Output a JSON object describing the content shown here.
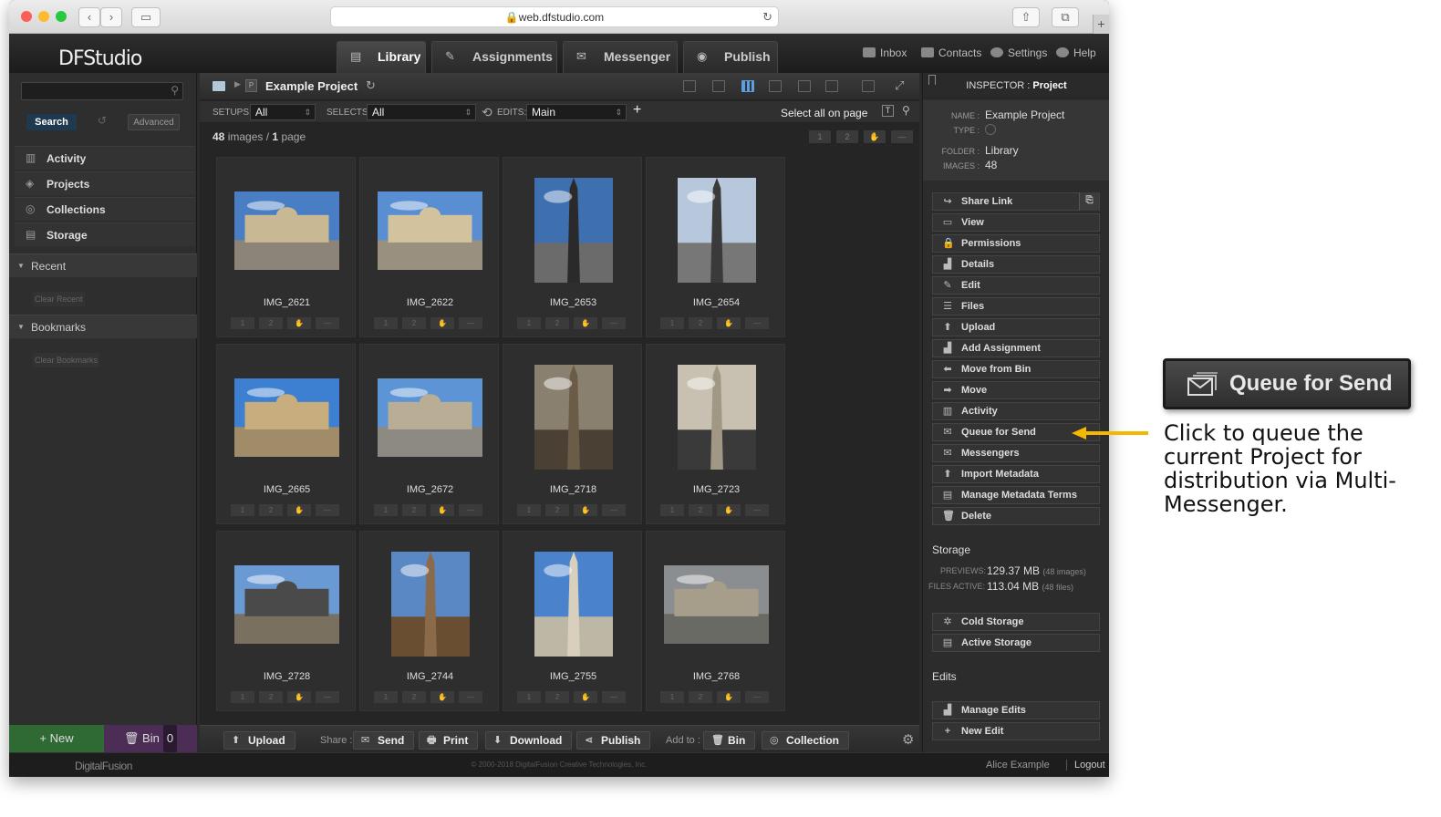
{
  "browser": {
    "url": "web.dfstudio.com"
  },
  "app": {
    "logo": "DFStudio"
  },
  "tabs": [
    {
      "label": "Library",
      "icon": "library-icon",
      "active": true
    },
    {
      "label": "Assignments",
      "icon": "assignments-icon",
      "active": false
    },
    {
      "label": "Messenger",
      "icon": "messenger-icon",
      "active": false
    },
    {
      "label": "Publish",
      "icon": "publish-icon",
      "active": false
    }
  ],
  "toplinks": [
    "Inbox",
    "Contacts",
    "Settings",
    "Help"
  ],
  "sidebar": {
    "search_button": "Search",
    "advanced_button": "Advanced",
    "nav": [
      "Activity",
      "Projects",
      "Collections",
      "Storage"
    ],
    "recent": {
      "title": "Recent",
      "clear": "Clear Recent"
    },
    "bookmarks": {
      "title": "Bookmarks",
      "clear": "Clear Bookmarks"
    },
    "new_button": "+ New",
    "bin_label": "Bin",
    "bin_count": "0"
  },
  "main": {
    "title": "Example Project",
    "setups_label": "SETUPS:",
    "setups_value": "All",
    "selects_label": "SELECTS:",
    "selects_value": "All",
    "edits_label": "EDITS:",
    "edits_value": "Main",
    "add": "+",
    "select_all": "Select all on page",
    "image_count": "48",
    "images_word": "images",
    "page_count": "1",
    "page_word": "page",
    "images": [
      "IMG_2621",
      "IMG_2622",
      "IMG_2653",
      "IMG_2654",
      "IMG_2665",
      "IMG_2672",
      "IMG_2718",
      "IMG_2723",
      "IMG_2728",
      "IMG_2744",
      "IMG_2755",
      "IMG_2768"
    ],
    "rating": [
      "1",
      "2"
    ],
    "bottom": {
      "upload": "Upload",
      "share_label": "Share :",
      "send": "Send",
      "print": "Print",
      "download": "Download",
      "publish": "Publish",
      "addto_label": "Add to :",
      "bin": "Bin",
      "collection": "Collection"
    }
  },
  "inspector": {
    "header_prefix": "INSPECTOR :",
    "header_obj": "Project",
    "name_key": "NAME :",
    "name_val": "Example Project",
    "type_key": "TYPE :",
    "folder_key": "FOLDER :",
    "folder_val": "Library",
    "images_key": "IMAGES :",
    "images_val": "48",
    "actions": [
      "Share Link",
      "View",
      "Permissions",
      "Details",
      "Edit",
      "Files",
      "Upload",
      "Add Assignment",
      "Move from Bin",
      "Move",
      "Activity",
      "Queue for Send",
      "Messengers",
      "Import Metadata",
      "Manage Metadata Terms",
      "Delete"
    ],
    "storage_title": "Storage",
    "previews_key": "PREVIEWS:",
    "previews_val": "129.37 MB",
    "previews_sub": "(48 images)",
    "files_key": "FILES ACTIVE:",
    "files_val": "113.04 MB",
    "files_sub": "(48 files)",
    "storage_actions": [
      "Cold Storage",
      "Active Storage"
    ],
    "edits_title": "Edits",
    "edit_actions": [
      "Manage Edits",
      "New Edit"
    ]
  },
  "footer": {
    "logo": "DigitalFusion",
    "copyright": "© 2000-2018 DigitalFusion Creative Technologies, Inc.",
    "user": "Alice Example",
    "logout": "Logout"
  },
  "callout": {
    "button": "Queue for Send",
    "text": "Click to queue the current Project for distribution via Multi-Messenger.",
    "arrow_color": "#f5b800"
  }
}
